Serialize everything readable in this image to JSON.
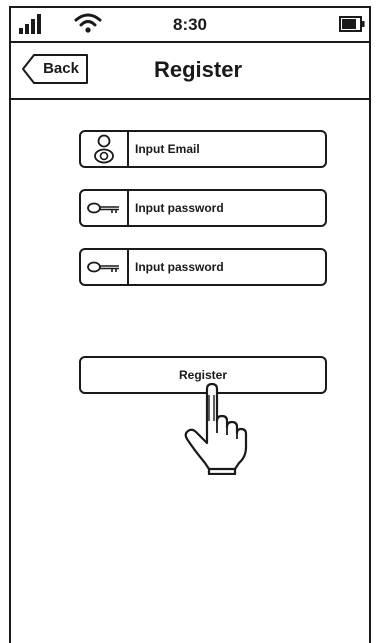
{
  "status_bar": {
    "time": "8:30",
    "icons": [
      "signal-bars-icon",
      "wifi-icon",
      "battery-icon"
    ]
  },
  "nav": {
    "back_label": "Back",
    "title": "Register"
  },
  "form": {
    "email": {
      "placeholder": "Input Email",
      "value": "",
      "icon": "user-icon"
    },
    "password": {
      "placeholder": "Input password",
      "value": "",
      "icon": "key-icon"
    },
    "confirm_password": {
      "placeholder": "Input password",
      "value": "",
      "icon": "key-icon"
    },
    "submit_label": "Register"
  },
  "overlay": {
    "icon": "pointing-hand-icon"
  },
  "colors": {
    "ink": "#1a1a1a",
    "background": "#ffffff"
  }
}
